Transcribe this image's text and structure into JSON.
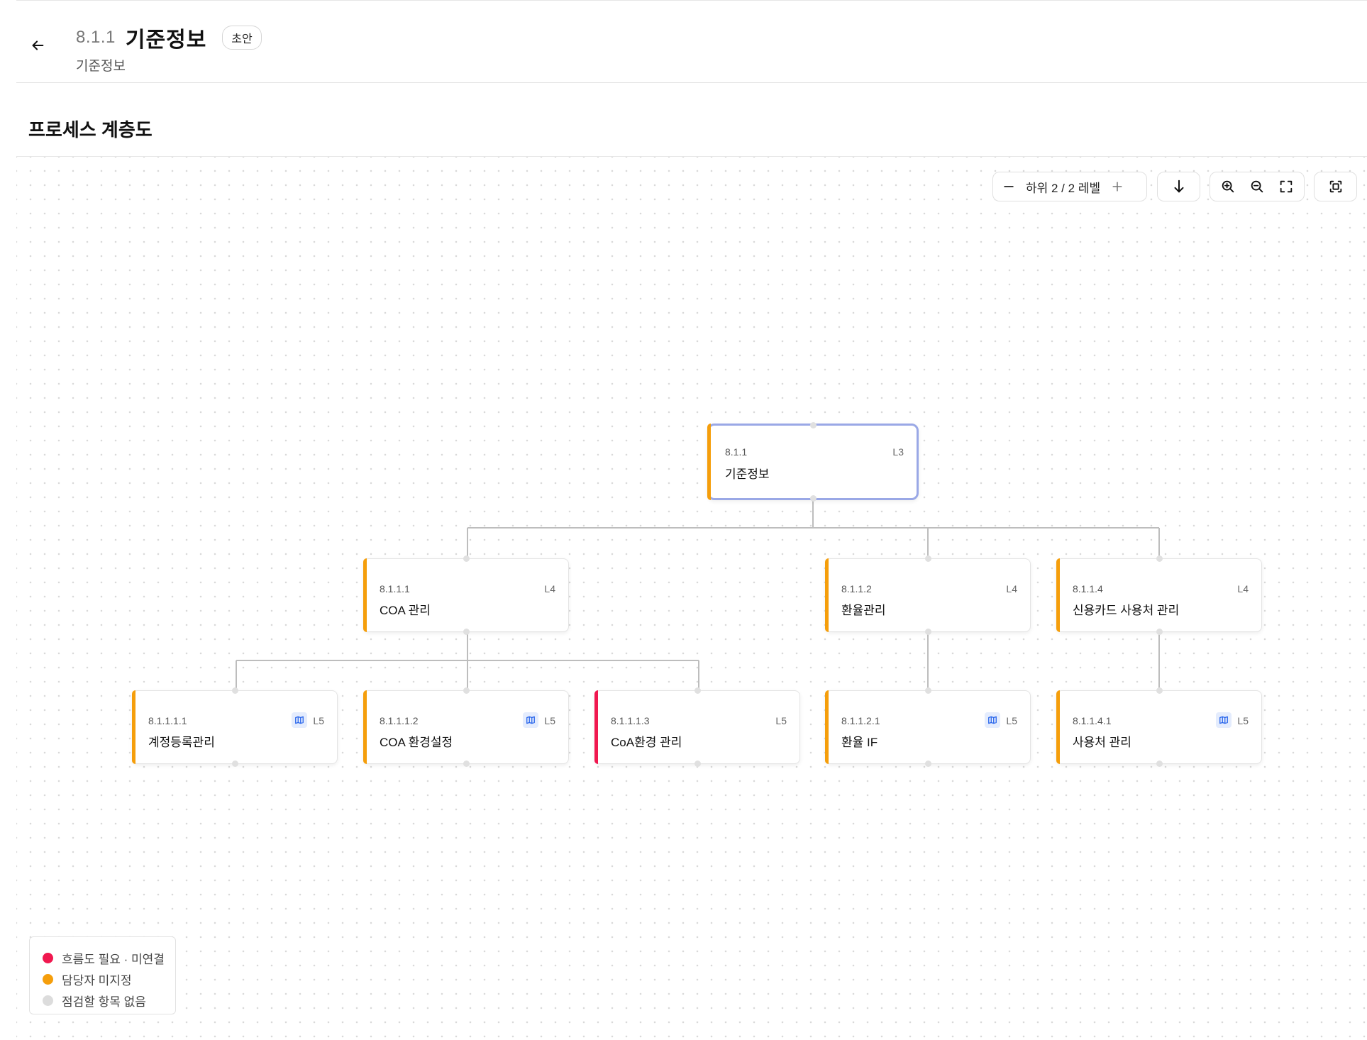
{
  "header": {
    "code": "8.1.1",
    "title": "기준정보",
    "status": "초안",
    "subtitle": "기준정보"
  },
  "section": {
    "title": "프로세스 계층도"
  },
  "toolbar": {
    "level_label": "하위 2 / 2 레벨"
  },
  "colors": {
    "amber": "#f59e0b",
    "red": "#f0184f",
    "grey": "#dcdcdc",
    "root_border": "#9aa8e6"
  },
  "nodes": {
    "root": {
      "code": "8.1.1",
      "level": "L3",
      "name": "기준정보"
    },
    "n1": {
      "code": "8.1.1.1",
      "level": "L4",
      "name": "COA 관리"
    },
    "n2": {
      "code": "8.1.1.2",
      "level": "L4",
      "name": "환율관리"
    },
    "n4": {
      "code": "8.1.1.4",
      "level": "L4",
      "name": "신용카드 사용처 관리"
    },
    "n11": {
      "code": "8.1.1.1.1",
      "level": "L5",
      "name": "계정등록관리",
      "has_map": true
    },
    "n12": {
      "code": "8.1.1.1.2",
      "level": "L5",
      "name": "COA 환경설정",
      "has_map": true
    },
    "n13": {
      "code": "8.1.1.1.3",
      "level": "L5",
      "name": "CoA환경 관리",
      "has_map": false
    },
    "n21": {
      "code": "8.1.1.2.1",
      "level": "L5",
      "name": "환율 IF",
      "has_map": true
    },
    "n41": {
      "code": "8.1.1.4.1",
      "level": "L5",
      "name": "사용처 관리",
      "has_map": true
    }
  },
  "legend": {
    "items": [
      {
        "label": "흐름도 필요 · 미연결",
        "color": "#f0184f"
      },
      {
        "label": "담당자 미지정",
        "color": "#f59e0b"
      },
      {
        "label": "점검할 항목 없음",
        "color": "#dcdcdc"
      }
    ]
  }
}
